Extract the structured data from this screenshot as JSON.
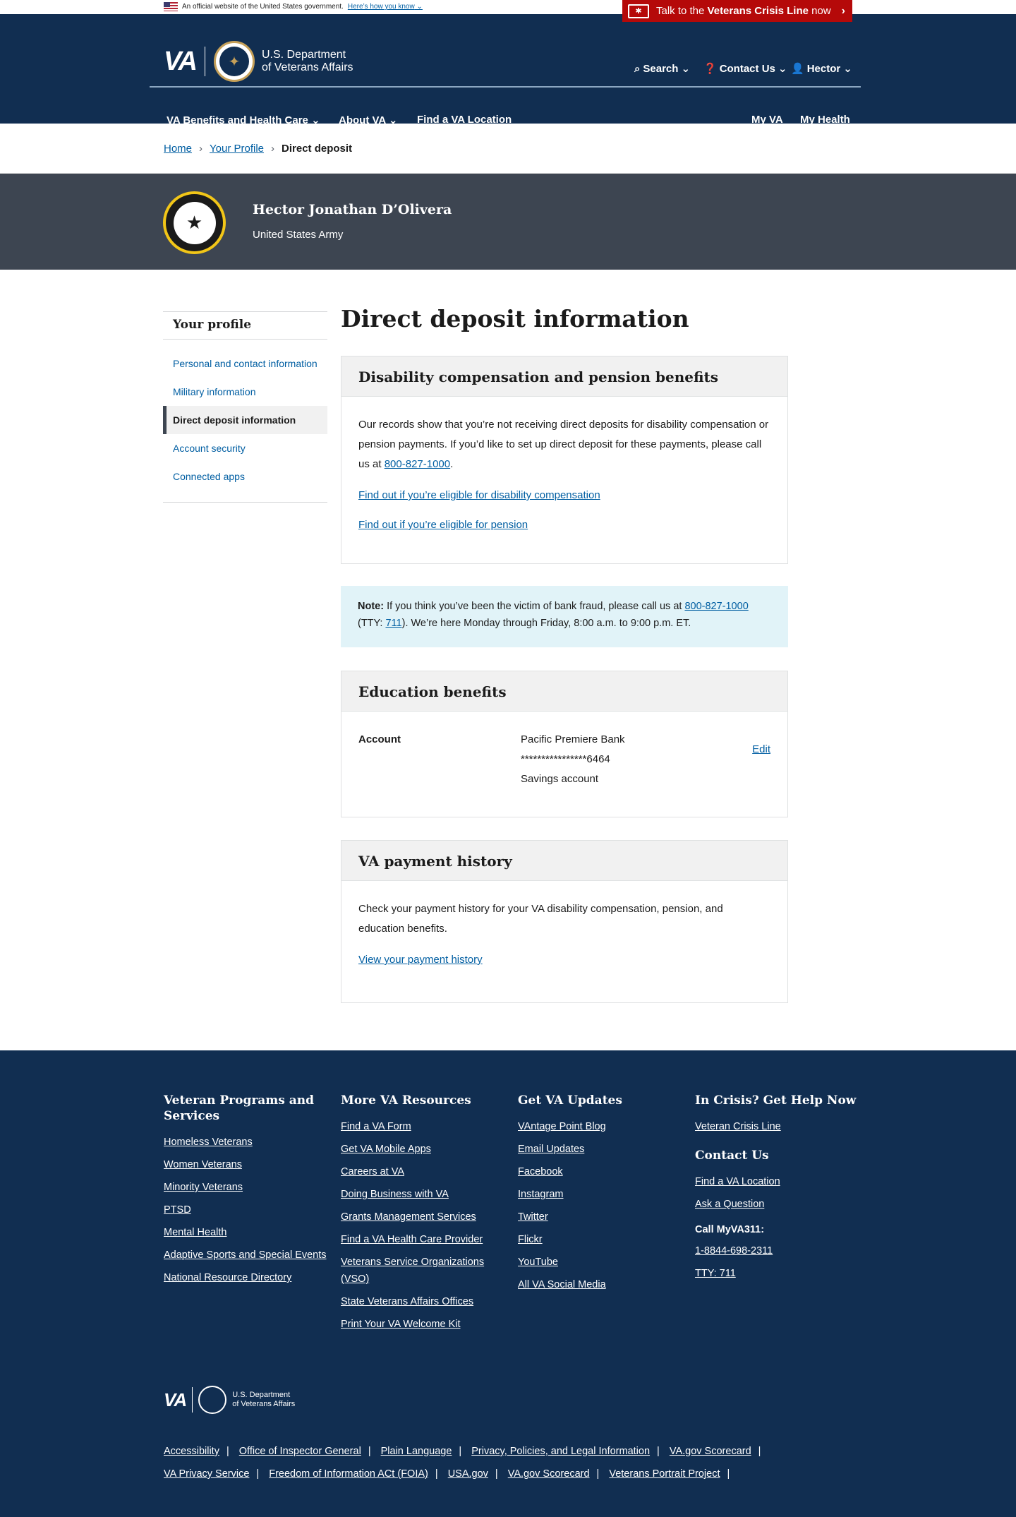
{
  "banner": {
    "text": "An official website of the United States government.",
    "link": "Here’s how you know"
  },
  "crisis": {
    "prefix": "Talk to the",
    "bold": "Veterans Crisis Line",
    "suffix": "now"
  },
  "header": {
    "logo_text": "VA",
    "dept_line1": "U.S. Department",
    "dept_line2": "of Veterans Affairs",
    "search": "Search",
    "contact": "Contact Us",
    "user": "Hector",
    "nav": [
      "VA Benefits and Health Care",
      "About VA",
      "Find a VA Location"
    ],
    "nav_right": [
      "My VA",
      "My Health"
    ]
  },
  "breadcrumb": {
    "home": "Home",
    "profile": "Your Profile",
    "current": "Direct deposit"
  },
  "hero": {
    "name": "Hector Jonathan D’Olivera",
    "branch": "United States Army"
  },
  "sidenav": {
    "title": "Your profile",
    "items": [
      "Personal and contact information",
      "Military information",
      "Direct deposit information",
      "Account security",
      "Connected apps"
    ]
  },
  "main": {
    "title": "Direct deposit information",
    "disability": {
      "title": "Disability compensation and pension benefits",
      "text": "Our records show that you’re not receiving direct deposits for disability compensation or pension payments. If you’d like to set up direct deposit for these payments, please call us at",
      "phone": "800-827-1000",
      "link1": "Find out if you’re eligible for disability compensation",
      "link2": "Find out if you’re eligible for pension"
    },
    "note": {
      "label": "Note:",
      "text": "If you think you’ve been the victim of bank fraud, please call us at",
      "phone": "800-827-1000",
      "tty_prefix": "(TTY:",
      "tty": "711",
      "text2": "). We’re here Monday through Friday, 8:00 a.m. to 9:00 p.m. ET."
    },
    "education": {
      "title": "Education benefits",
      "label": "Account",
      "bank": "Pacific Premiere Bank",
      "number": "****************6464",
      "type": "Savings account",
      "edit": "Edit"
    },
    "history": {
      "title": "VA payment history",
      "text": "Check your payment history for your VA disability compensation, pension, and education benefits.",
      "link": "View your payment history"
    }
  },
  "footer": {
    "col1": {
      "title": "Veteran Programs and Services",
      "links": [
        "Homeless Veterans",
        "Women Veterans",
        "Minority Veterans",
        "PTSD",
        "Mental Health",
        "Adaptive Sports and Special Events",
        "National Resource Directory"
      ]
    },
    "col2": {
      "title": "More VA Resources",
      "links": [
        "Find a VA Form",
        "Get VA Mobile Apps",
        "Careers at VA",
        "Doing Business with VA",
        "Grants Management Services",
        "Find a VA Health Care Provider",
        "Veterans Service Organizations (VSO)",
        "State Veterans Affairs Offices",
        "Print Your VA Welcome Kit"
      ]
    },
    "col3": {
      "title": "Get VA Updates",
      "links": [
        "VAntage Point Blog",
        "Email Updates",
        "Facebook",
        "Instagram",
        "Twitter",
        "Flickr",
        "YouTube",
        "All VA Social Media"
      ]
    },
    "col4": {
      "title": "In Crisis? Get Help Now",
      "crisis_link": "Veteran Crisis Line",
      "contact_title": "Contact Us",
      "contact_links": [
        "Find a VA Location",
        "Ask a Question"
      ],
      "call_label": "Call MyVA311:",
      "phone": "1-8844-698-2311",
      "tty": "TTY: 711"
    },
    "logo_text": "VA",
    "dept_line1": "U.S. Department",
    "dept_line2": "of Veterans Affairs",
    "bottom_row1": [
      "Accessibility",
      "Office of Inspector General",
      "Plain Language",
      "Privacy, Policies, and Legal Information",
      "VA.gov Scorecard"
    ],
    "bottom_row2": [
      "VA Privacy Service",
      "Freedom of Information ACt (FOIA)",
      "USA.gov",
      "VA.gov Scorecard",
      "Veterans Portrait Project"
    ]
  },
  "colors": {
    "navy": "#112e51",
    "hero": "#3d4551",
    "link": "#005ea2",
    "crisis": "#b50909",
    "note_bg": "#e1f3f8"
  }
}
